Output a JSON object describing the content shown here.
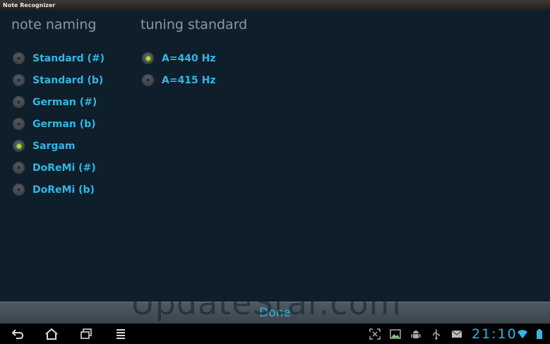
{
  "window": {
    "title": "Note Recognizer"
  },
  "note_naming": {
    "heading": "note naming",
    "options": [
      {
        "label": "Standard (#)",
        "checked": false
      },
      {
        "label": "Standard (b)",
        "checked": false
      },
      {
        "label": "German (#)",
        "checked": false
      },
      {
        "label": "German (b)",
        "checked": false
      },
      {
        "label": "Sargam",
        "checked": true
      },
      {
        "label": "DoReMi (#)",
        "checked": false
      },
      {
        "label": "DoReMi (b)",
        "checked": false
      }
    ]
  },
  "tuning_standard": {
    "heading": "tuning standard",
    "options": [
      {
        "label": "A=440 Hz",
        "checked": true
      },
      {
        "label": "A=415 Hz",
        "checked": false
      }
    ]
  },
  "footer": {
    "done_label": "Done"
  },
  "watermark": {
    "text": "UpdateStar.com"
  },
  "system_bar": {
    "clock": "21:10",
    "nav_icons": [
      "back-icon",
      "home-icon",
      "recent-apps-icon",
      "menu-icon"
    ],
    "status_icons": [
      "screenshot-icon",
      "gallery-icon",
      "android-debug-icon",
      "usb-icon",
      "email-icon",
      "wifi-icon",
      "battery-icon"
    ]
  },
  "colors": {
    "accent": "#33b5e5",
    "radio_checked": "#a6e81c",
    "background": "#0e1e2b",
    "heading": "#8a98a4"
  }
}
